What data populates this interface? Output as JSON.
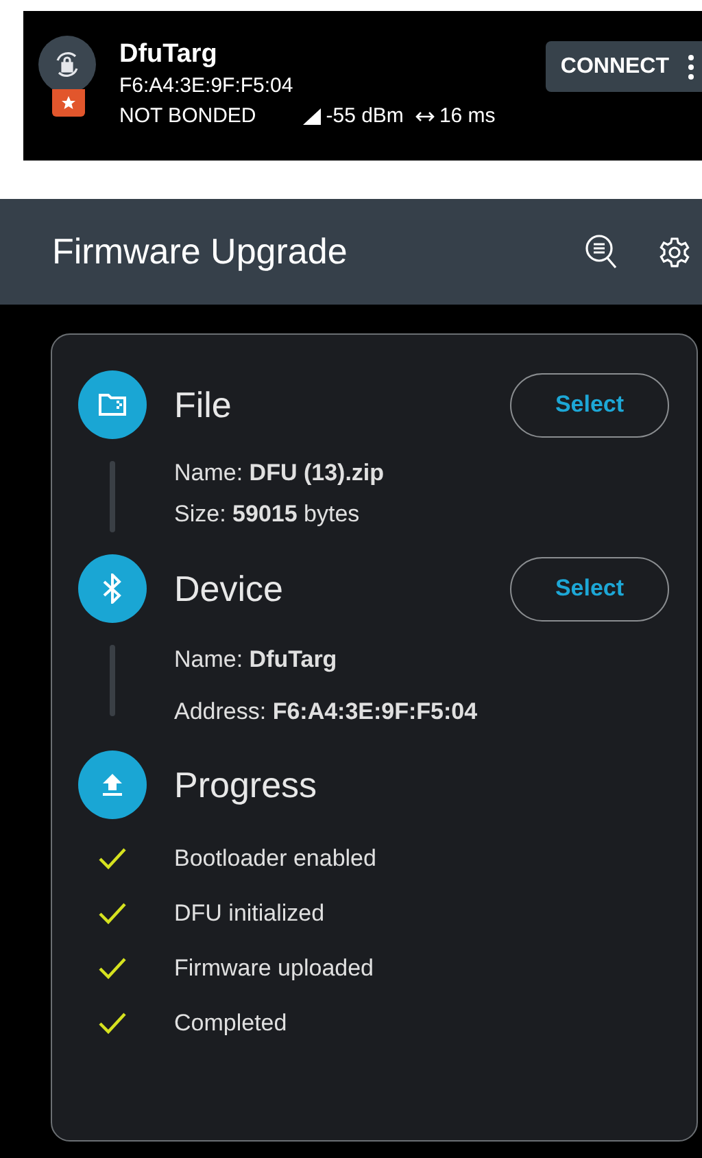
{
  "scan_result": {
    "name": "DfuTarg",
    "address": "F6:A4:3E:9F:F5:04",
    "bond_state": "NOT BONDED",
    "rssi": "-55 dBm",
    "interval": "16 ms",
    "favorite": true,
    "connect_button": "CONNECT"
  },
  "app_bar": {
    "title": "Firmware Upgrade"
  },
  "sections": [
    {
      "kind": "file",
      "title": "File",
      "button": "Select",
      "details": [
        "Name: **DFU (13).zip**",
        "Size: **59015** bytes"
      ]
    },
    {
      "kind": "device",
      "title": "Device",
      "button": "Select",
      "details": [
        "Name: **DfuTarg**",
        "Address: **F6:A4:3E:9F:F5:04**"
      ]
    },
    {
      "kind": "progress",
      "title": "Progress",
      "steps": [
        {
          "label": "Bootloader enabled",
          "checked": true
        },
        {
          "label": "DFU initialized",
          "checked": true
        },
        {
          "label": "Firmware uploaded",
          "checked": true
        },
        {
          "label": "Completed",
          "checked": true
        }
      ]
    }
  ]
}
